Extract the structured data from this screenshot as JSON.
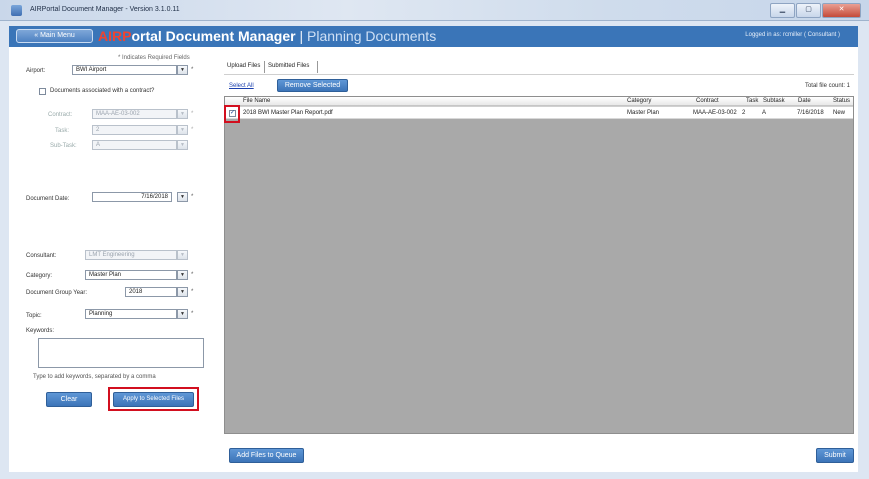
{
  "window": {
    "title": "AIRPortal Document Manager - Version 3.1.0.11"
  },
  "header": {
    "main_menu": "« Main Menu",
    "brand_logo": "AIRP",
    "brand_name": "ortal Document Manager",
    "separator": "|",
    "page_title": "Planning Documents",
    "login_info": "Logged in as: rcmiller ( Consultant )"
  },
  "form": {
    "required_note": "* Indicates Required Fields",
    "airport_label": "Airport:",
    "airport_value": "BWI Airport",
    "contract_checkbox_label": "Documents associated with a contract?",
    "contract_label": "Contract:",
    "contract_value": "MAA-AE-03-002",
    "task_label": "Task:",
    "task_value": "2",
    "subtask_label": "Sub-Task:",
    "subtask_value": "A",
    "doc_date_label": "Document Date:",
    "doc_date_value": "7/16/2018",
    "consultant_label": "Consultant:",
    "consultant_value": "LMT Engineering",
    "category_label": "Category:",
    "category_value": "Master Plan",
    "group_year_label": "Document Group Year:",
    "group_year_value": "2018",
    "topic_label": "Topic:",
    "topic_value": "Planning",
    "keywords_label": "Keywords:",
    "keywords_hint": "Type to add keywords, separated by a comma",
    "required_star": "*",
    "clear_button": "Clear",
    "apply_button": "Apply to Selected Files"
  },
  "files": {
    "tabs": [
      "Upload Files",
      "Submitted Files"
    ],
    "select_all": "Select All",
    "remove_selected": "Remove Selected",
    "total_count": "Total file count: 1",
    "columns": [
      "File Name",
      "Category",
      "Contract",
      "Task",
      "Subtask",
      "Date",
      "Status"
    ],
    "rows": [
      {
        "checked": true,
        "file_name": "2018 BWI Master Plan Report.pdf",
        "category": "Master Plan",
        "contract": "MAA-AE-03-002",
        "task": "2",
        "subtask": "A",
        "date": "7/16/2018",
        "status": "New"
      }
    ],
    "add_files_button": "Add Files to Queue",
    "submit_button": "Submit"
  },
  "colors": {
    "header_blue": "#3a75b8",
    "logo_red": "#ef4430",
    "highlight_red": "#d20f1f",
    "grid_gray": "#a9a9a9"
  }
}
